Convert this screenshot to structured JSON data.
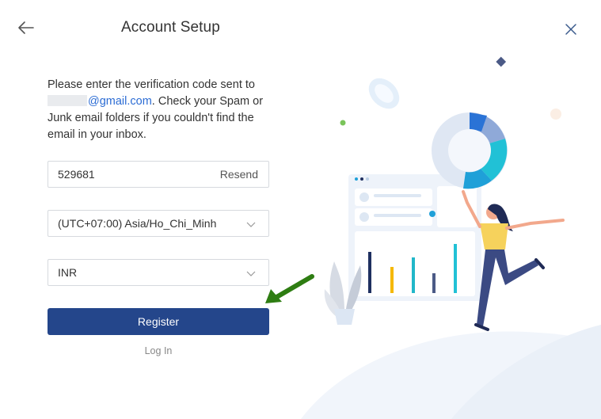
{
  "dialog": {
    "title": "Account Setup"
  },
  "instructions": {
    "line1": "Please enter the verification code sent to",
    "email_domain": "@gmail.com",
    "rest": ". Check your Spam or Junk email folders if you couldn't find the email in your inbox."
  },
  "code_field": {
    "value": "529681",
    "resend_label": "Resend"
  },
  "timezone_select": {
    "value": "(UTC+07:00) Asia/Ho_Chi_Minh"
  },
  "currency_select": {
    "value": "INR"
  },
  "register_button": {
    "label": "Register",
    "color": "#24468b"
  },
  "login_link": {
    "label": "Log In"
  },
  "annotation": {
    "arrow_color": "#2e7d12"
  },
  "icons": {
    "back": "arrow-left-icon",
    "close": "close-icon",
    "dropdown": "chevron-down-icon"
  }
}
